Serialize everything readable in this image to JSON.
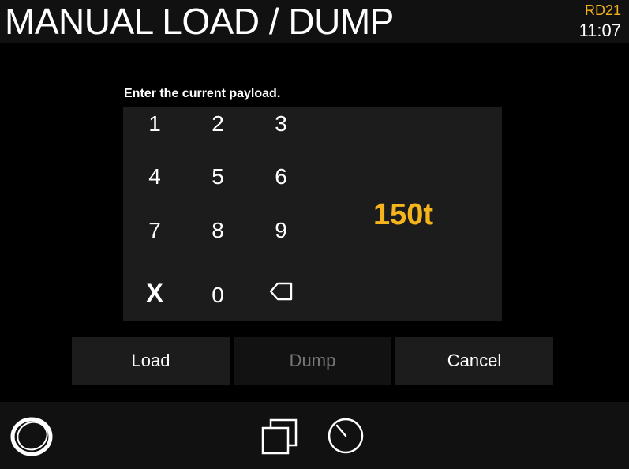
{
  "header": {
    "title": "MANUAL LOAD / DUMP",
    "unit_id": "RD21",
    "time": "11:07"
  },
  "prompt": "Enter the current payload.",
  "keypad": {
    "keys": [
      "1",
      "2",
      "3",
      "4",
      "5",
      "6",
      "7",
      "8",
      "9",
      "X",
      "0"
    ],
    "backspace_icon": "backspace-icon"
  },
  "payload": "150t",
  "actions": {
    "load": "Load",
    "dump": "Dump",
    "cancel": "Cancel"
  },
  "footer": {
    "icons": [
      "logo-icon",
      "copy-pages-icon",
      "timer-icon"
    ]
  },
  "colors": {
    "accent": "#f5b41d",
    "panel": "#1c1c1c",
    "background": "#000000"
  }
}
